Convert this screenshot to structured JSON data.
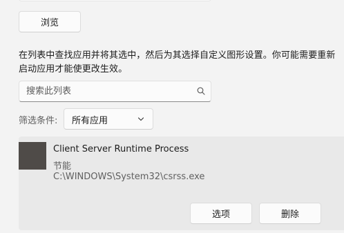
{
  "browse_label": "浏览",
  "description": "在列表中查找应用并将其选中，然后为其选择自定义图形设置。你可能需要重新启动应用才能使更改生效。",
  "search": {
    "placeholder": "搜索此列表",
    "value": ""
  },
  "filter": {
    "label": "筛选条件:",
    "selected": "所有应用"
  },
  "app": {
    "name": "Client Server Runtime Process",
    "mode": "节能",
    "path": "C:\\WINDOWS\\System32\\csrss.exe"
  },
  "buttons": {
    "options_label": "选项",
    "remove_label": "删除"
  }
}
